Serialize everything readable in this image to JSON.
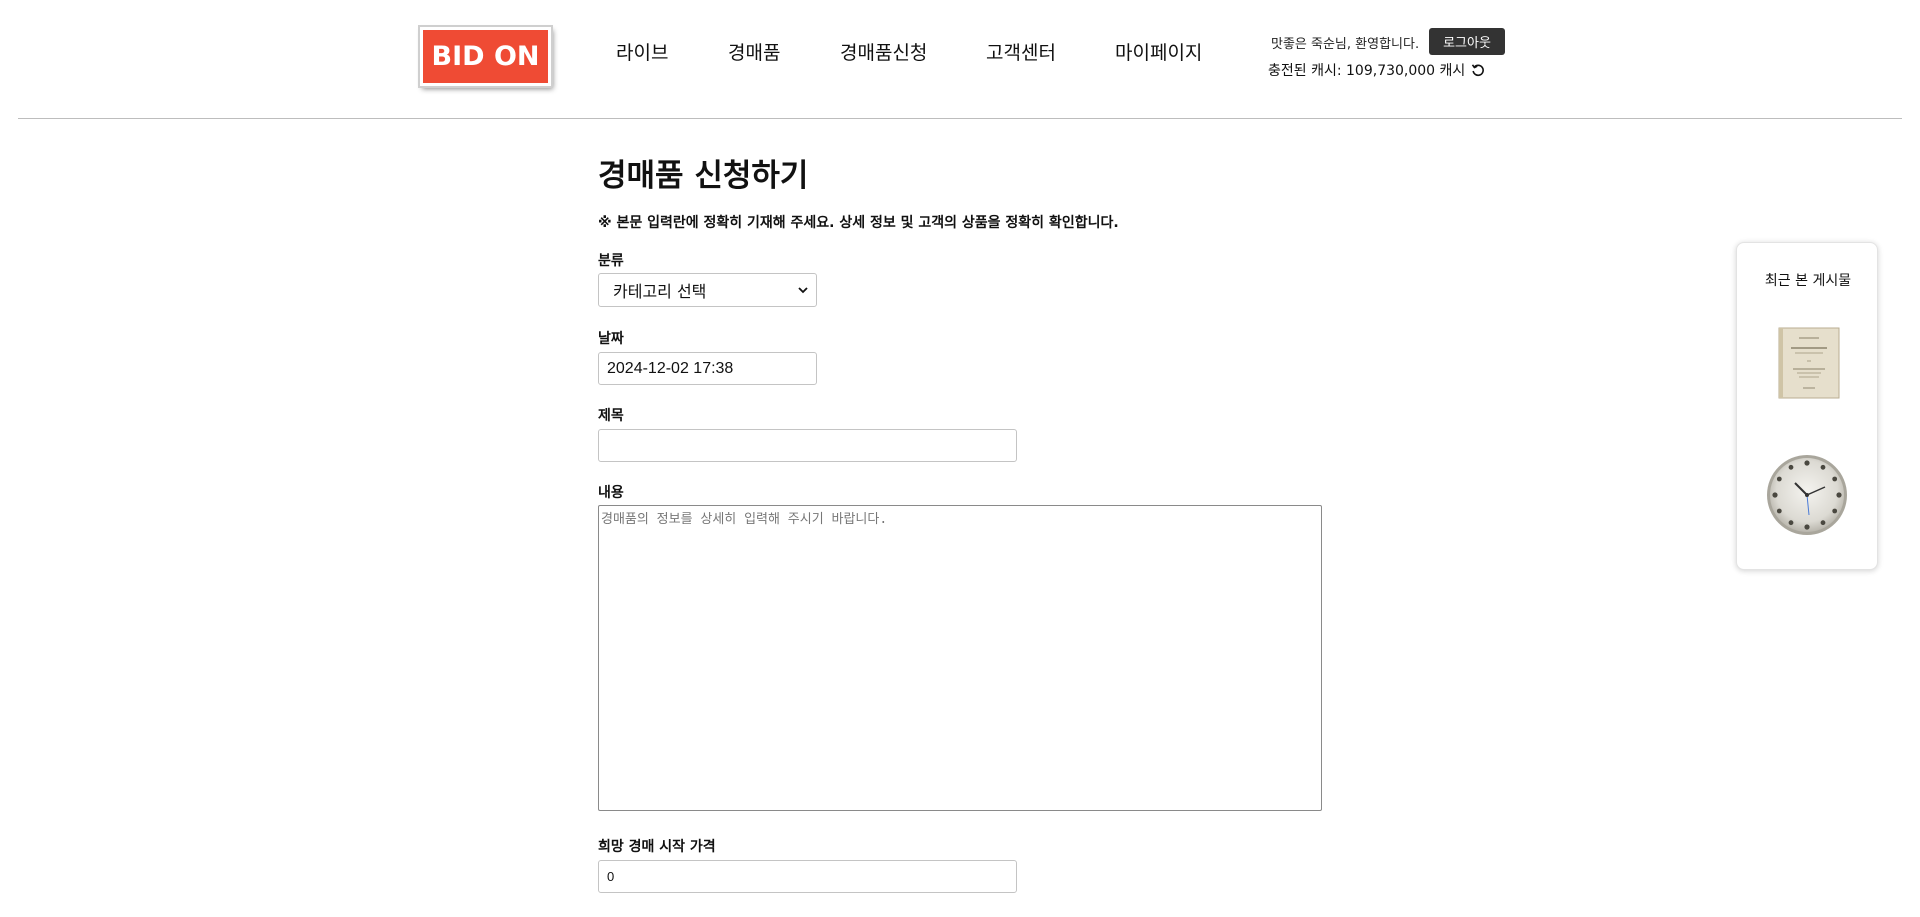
{
  "header": {
    "logo_text": "BID ON",
    "nav": [
      "라이브",
      "경매품",
      "경매품신청",
      "고객센터",
      "마이페이지"
    ],
    "welcome_text": "맛좋은 죽순님, 환영합니다.",
    "logout_label": "로그아웃",
    "cash_text": "충전된 캐시: 109,730,000 캐시"
  },
  "form": {
    "title": "경매품 신청하기",
    "notice": "※ 본문 입력란에 정확히 기재해 주세요. 상세 정보 및 고객의 상품을 정확히 확인합니다.",
    "category_label": "분류",
    "category_selected": "카테고리 선택",
    "date_label": "날짜",
    "date_value": "2024-12-02 17:38",
    "title_label": "제목",
    "title_value": "",
    "content_label": "내용",
    "content_placeholder": "경매품의 정보를 상세히 입력해 주시기 바랍니다.",
    "price_label": "희망 경매 시작 가격",
    "price_value": "0"
  },
  "recent": {
    "title": "최근 본 게시물",
    "items": [
      "book-thumbnail",
      "clock-thumbnail"
    ]
  },
  "colors": {
    "logo_bg": "#ef4b34",
    "logout_bg": "#333333"
  }
}
